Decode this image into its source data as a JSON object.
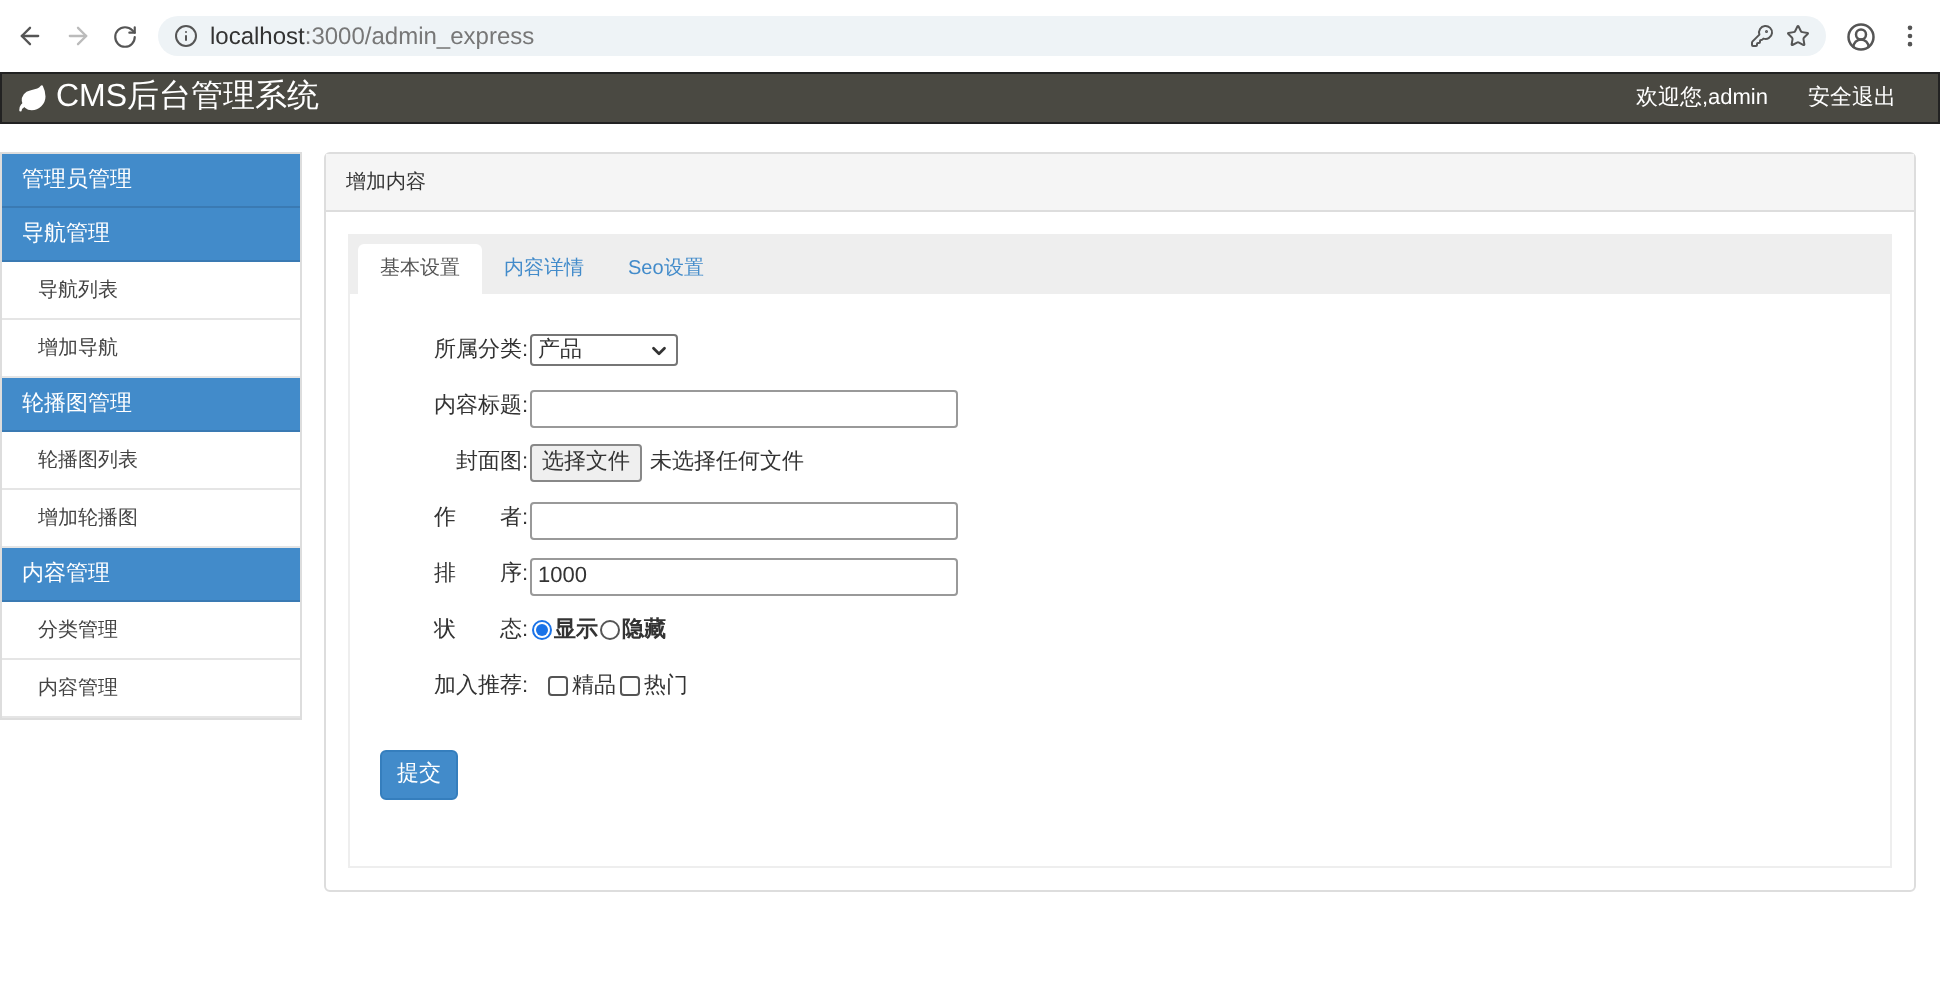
{
  "browser": {
    "url_host": "localhost",
    "url_rest": ":3000/admin_express"
  },
  "header": {
    "title": "CMS后台管理系统",
    "welcome": "欢迎您,admin",
    "logout": "安全退出"
  },
  "sidebar": [
    {
      "label": "管理员管理"
    },
    {
      "label": "导航管理",
      "children": [
        {
          "label": "导航列表"
        },
        {
          "label": "增加导航"
        }
      ]
    },
    {
      "label": "轮播图管理",
      "children": [
        {
          "label": "轮播图列表"
        },
        {
          "label": "增加轮播图"
        }
      ]
    },
    {
      "label": "内容管理",
      "children": [
        {
          "label": "分类管理"
        },
        {
          "label": "内容管理"
        }
      ]
    }
  ],
  "panel": {
    "title": "增加内容",
    "tabs": [
      {
        "label": "基本设置",
        "selected": true
      },
      {
        "label": "内容详情",
        "selected": false
      },
      {
        "label": "Seo设置",
        "selected": false
      }
    ],
    "fields": [
      {
        "kind": "select",
        "label": "所属分类:",
        "value": "产品"
      },
      {
        "kind": "text",
        "label": "内容标题:"
      },
      {
        "kind": "file",
        "label": "封面图:",
        "button": "选择文件",
        "note": "未选择任何文件"
      },
      {
        "kind": "text",
        "label": "作　　者:"
      },
      {
        "kind": "text",
        "label": "排　　序:",
        "value": "1000"
      },
      {
        "kind": "radio",
        "label": "状　　态:",
        "options": [
          {
            "label": "显示",
            "selected": true
          },
          {
            "label": "隐藏",
            "selected": false
          }
        ]
      },
      {
        "kind": "checkbox",
        "label": "加入推荐:",
        "options": [
          {
            "label": "精品",
            "checked": false
          },
          {
            "label": "热门",
            "checked": false
          }
        ]
      }
    ],
    "submit": "提交"
  }
}
